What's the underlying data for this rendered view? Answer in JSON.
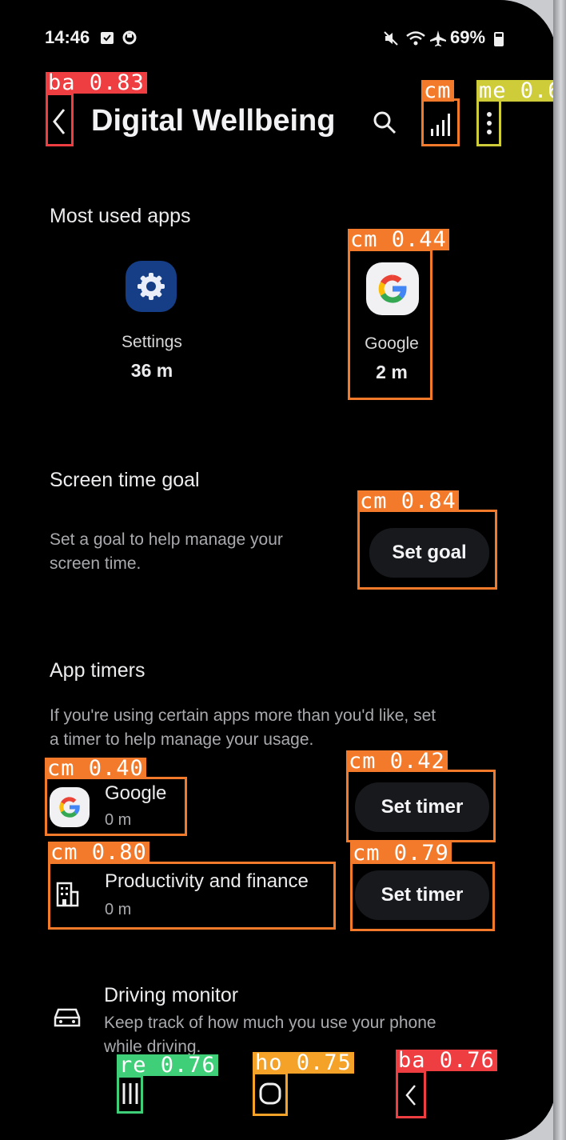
{
  "status_bar": {
    "time": "14:46",
    "battery": "69%",
    "icons": [
      "calendar-icon",
      "clock-icon",
      "mute-icon",
      "wifi-icon",
      "airplane-icon",
      "battery-icon"
    ]
  },
  "header": {
    "title": "Digital Wellbeing",
    "icons": [
      "back-icon",
      "search-icon",
      "chart-icon",
      "more-icon"
    ]
  },
  "most_used": {
    "title": "Most used apps",
    "apps": [
      {
        "name": "Settings",
        "time": "36 m",
        "icon": "settings-icon"
      },
      {
        "name": "Google",
        "time": "2 m",
        "icon": "google-icon"
      }
    ]
  },
  "screen_time_goal": {
    "title": "Screen time goal",
    "description_line1": "Set a goal to help manage your",
    "description_line2": "screen time.",
    "button": "Set goal"
  },
  "app_timers": {
    "title": "App timers",
    "description_line1": "If you're using certain apps more than you'd like, set",
    "description_line2": "a timer to help manage your usage.",
    "items": [
      {
        "name": "Google",
        "time": "0 m",
        "button": "Set timer",
        "icon": "google-icon"
      },
      {
        "name": "Productivity and finance",
        "time": "0 m",
        "button": "Set timer",
        "icon": "building-icon"
      }
    ]
  },
  "driving_monitor": {
    "title": "Driving monitor",
    "description_line1": "Keep track of how much you use your phone",
    "description_line2": "while driving."
  },
  "nav_bar": {
    "icons": [
      "recents-icon",
      "home-icon",
      "back-nav-icon"
    ]
  },
  "detections": [
    {
      "label": "ba 0.83",
      "color": "#ef3e42"
    },
    {
      "label": "cm",
      "color": "#f47a2b"
    },
    {
      "label": "me 0.6",
      "color": "#cfcc3a"
    },
    {
      "label": "cm 0.44",
      "color": "#f47a2b"
    },
    {
      "label": "cm 0.84",
      "color": "#f47a2b"
    },
    {
      "label": "cm 0.40",
      "color": "#f47a2b"
    },
    {
      "label": "cm 0.42",
      "color": "#f47a2b"
    },
    {
      "label": "cm 0.80",
      "color": "#f47a2b"
    },
    {
      "label": "cm 0.79",
      "color": "#f47a2b"
    },
    {
      "label": "re 0.76",
      "color": "#3fcf78"
    },
    {
      "label": "ho 0.75",
      "color": "#f4a228"
    },
    {
      "label": "ba 0.76",
      "color": "#ef3e42"
    }
  ]
}
